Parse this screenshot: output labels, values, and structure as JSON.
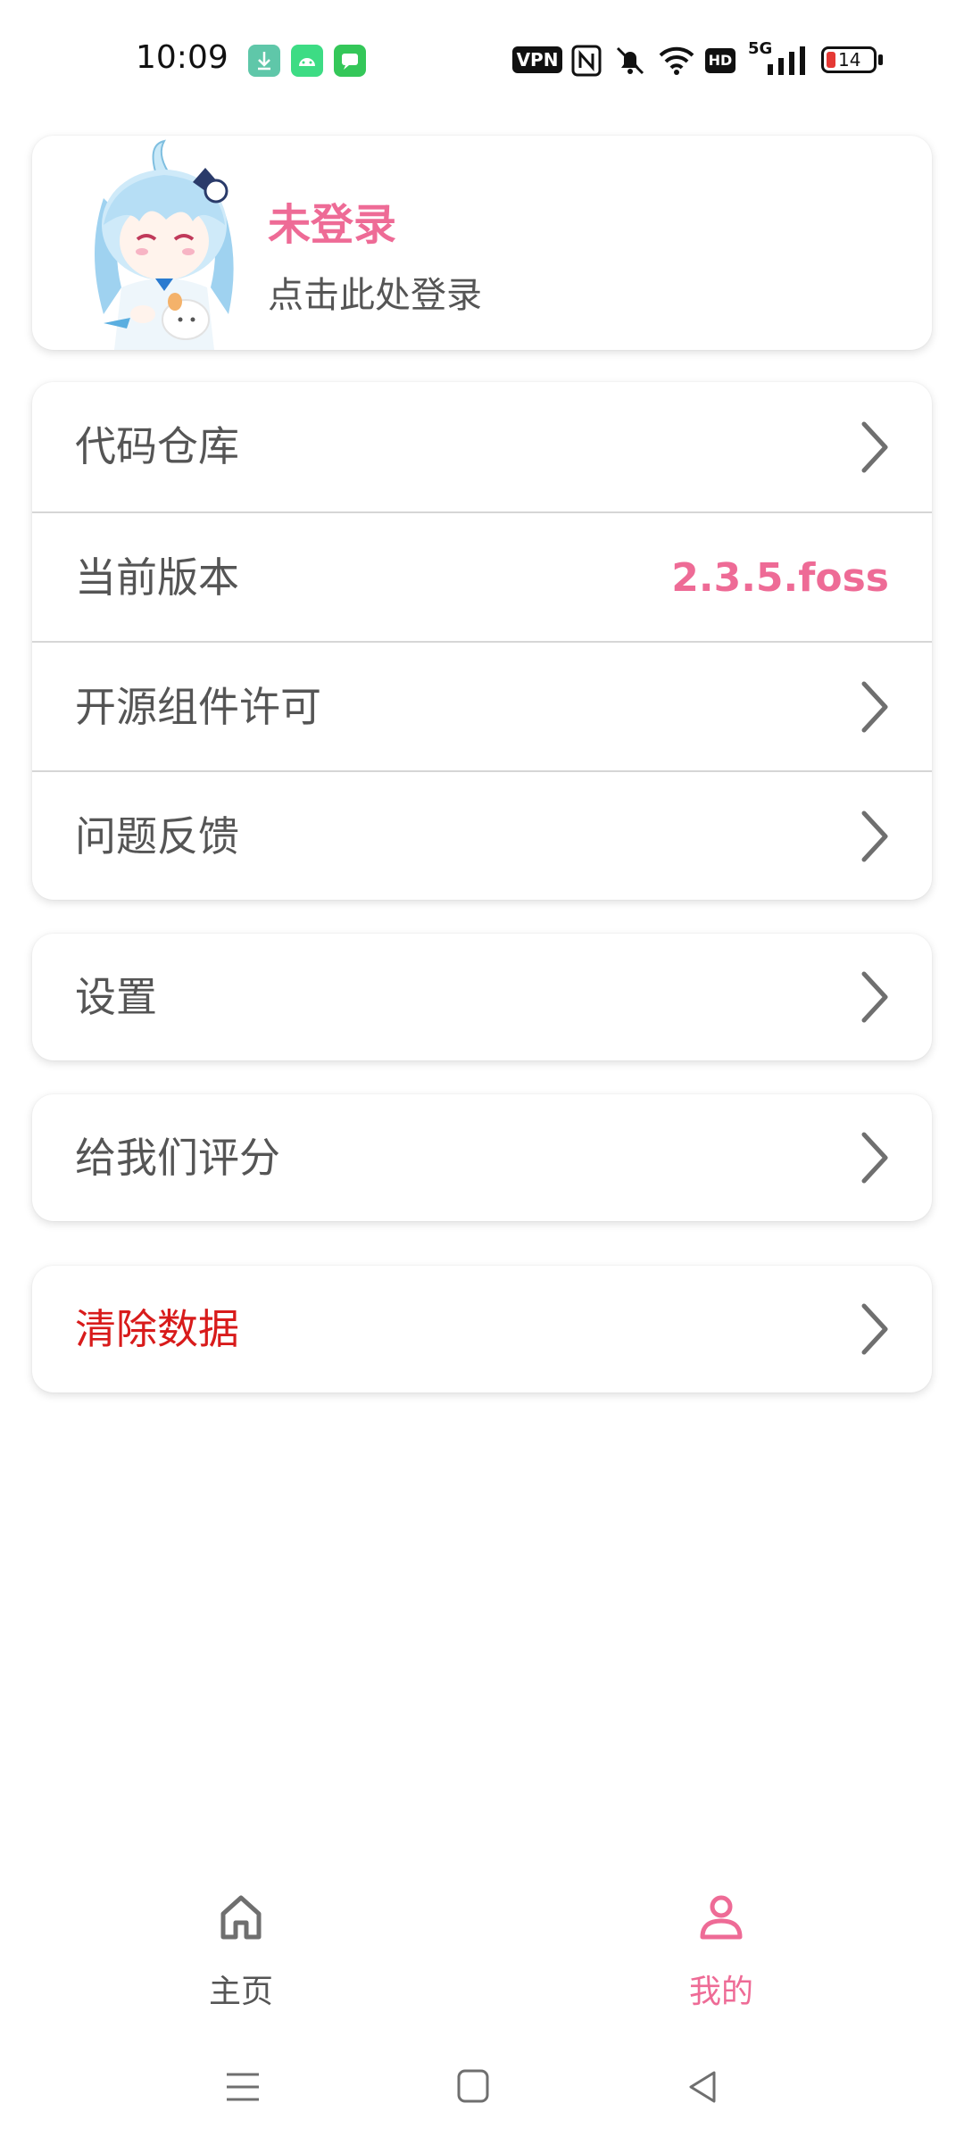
{
  "status_bar": {
    "time": "10:09",
    "vpn_label": "VPN",
    "network": "5G",
    "hd_label": "HD",
    "battery_level": "14",
    "icons": [
      "download-app-icon",
      "android-app-icon",
      "messages-app-icon",
      "nfc-icon",
      "mute-icon",
      "wifi-icon",
      "signal-icon",
      "battery-icon"
    ]
  },
  "profile": {
    "name": "未登录",
    "subtitle": "点击此处登录",
    "avatar_icon": "anime-avatar-icon"
  },
  "menu_group": [
    {
      "label": "代码仓库",
      "icon": "chevron-right-icon"
    },
    {
      "label": "当前版本",
      "value": "2.3.5.foss"
    },
    {
      "label": "开源组件许可",
      "icon": "chevron-right-icon"
    },
    {
      "label": "问题反馈",
      "icon": "chevron-right-icon"
    }
  ],
  "settings": {
    "label": "设置"
  },
  "rate": {
    "label": "给我们评分"
  },
  "clear_data": {
    "label": "清除数据"
  },
  "bottom_nav": {
    "home": {
      "label": "主页",
      "icon": "home-icon"
    },
    "mine": {
      "label": "我的",
      "icon": "person-icon"
    }
  },
  "colors": {
    "accent": "#ee6b96",
    "danger": "#d81b1b",
    "text": "#555555",
    "icon_gray": "#6f6f6f"
  }
}
